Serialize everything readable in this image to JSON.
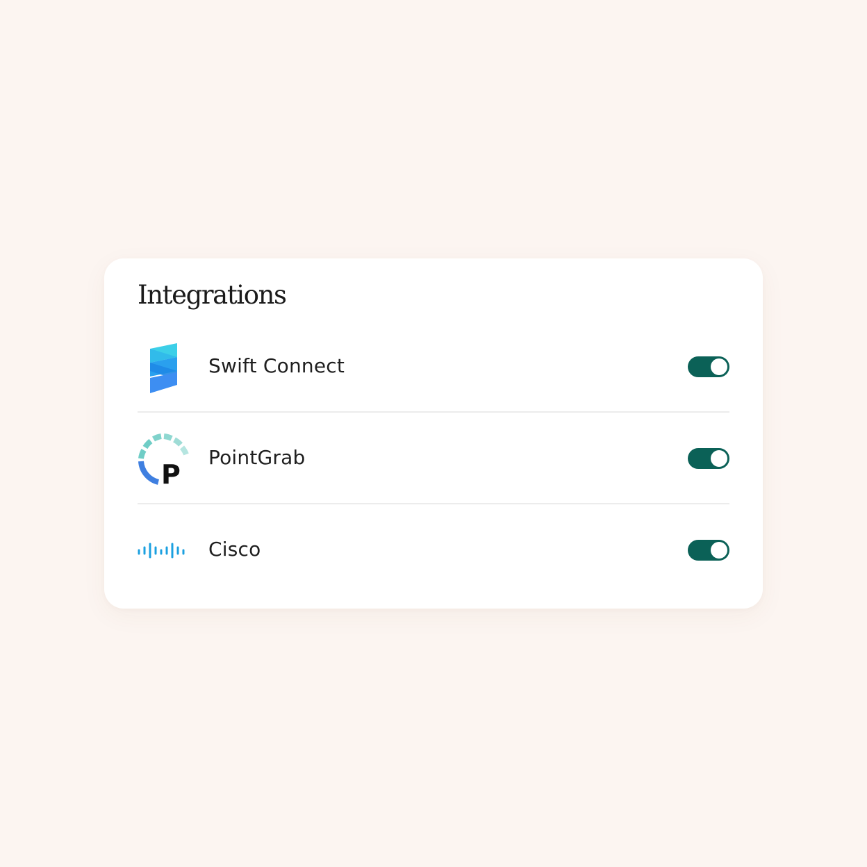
{
  "card": {
    "title": "Integrations"
  },
  "integrations": [
    {
      "name": "Swift Connect",
      "logo_icon": "swift-connect-logo",
      "enabled": true
    },
    {
      "name": "PointGrab",
      "logo_icon": "pointgrab-logo",
      "logo_letter": "P",
      "enabled": true
    },
    {
      "name": "Cisco",
      "logo_icon": "cisco-logo",
      "enabled": true
    }
  ],
  "colors": {
    "background": "#fcf5f1",
    "card": "#ffffff",
    "toggle_on": "#0b6157",
    "divider": "#ececec",
    "cisco_blue": "#1ba0e0",
    "pointgrab_teal": "#7fd2cb",
    "pointgrab_blue": "#3f7fe0",
    "swift_cyan": "#3ccfe8",
    "swift_blue": "#3d8ef2"
  }
}
